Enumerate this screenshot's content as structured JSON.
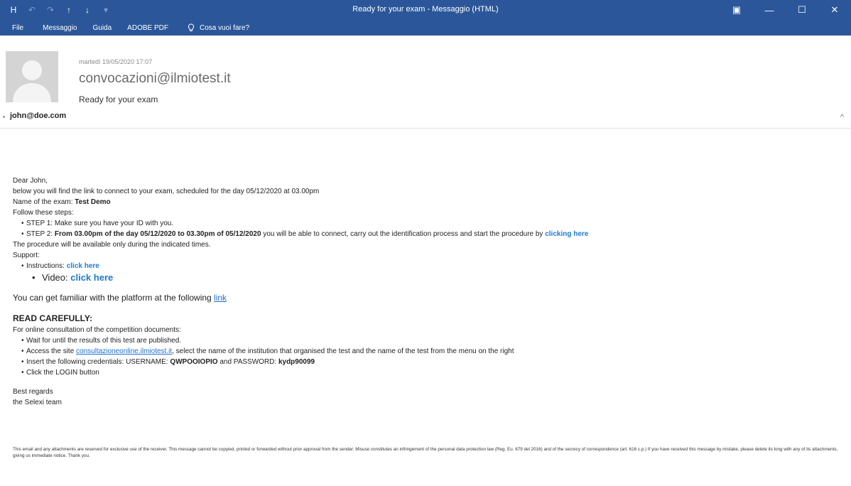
{
  "window": {
    "title": "Ready for your exam  -  Messaggio (HTML)",
    "controls": {
      "ribbon_options": "▣",
      "minimize": "—",
      "maximize": "☐",
      "close": "✕"
    }
  },
  "quick_access": {
    "save": "H",
    "undo": "↶",
    "redo": "↷",
    "up": "↑",
    "down": "↓",
    "more": "▾"
  },
  "ribbon": {
    "tabs": [
      "File",
      "Messaggio",
      "Guida",
      "ADOBE PDF"
    ],
    "tell_me": "Cosa vuoi fare?"
  },
  "header": {
    "date": "martedì 19/05/2020 17:07",
    "from": "convocazioni@ilmiotest.it",
    "subject": "Ready for your exam",
    "to": "john@doe.com",
    "collapse": "^"
  },
  "message": {
    "greeting": "Dear John,",
    "intro": "below you will find the link to connect to your exam, scheduled for the day 05/12/2020 at 03.00pm",
    "exam_label": "Name of the exam: ",
    "exam_name": "Test Demo",
    "steps_intro": "Follow these steps:",
    "step1": "STEP 1: Make sure you have your ID with you.",
    "step2_prefix": "STEP 2: ",
    "step2_bold": "From 03.00pm of the day 05/12/2020 to 03.30pm of 05/12/2020",
    "step2_text": " you will be able to connect, carry out the identification process and start the procedure by ",
    "step2_link": "clicking here",
    "availability": "The procedure will be available only during the indicated times.",
    "support_label": "Support:",
    "instructions_label": "Instructions: ",
    "instructions_link": "click here",
    "video_label": "Video: ",
    "video_link": "click here",
    "platform_text": "You can get familiar with the platform at the following ",
    "platform_link": "link",
    "read_carefully": "READ CAREFULLY:",
    "consult_intro": "For online consultation of the competition documents:",
    "consult1": "Wait for until the results of this test are published.",
    "consult2_prefix": "Access the site ",
    "consult2_link": "consultazioneonline.ilmiotest.it",
    "consult2_text": ", select the name of the institution that organised the test and the name of the test from the menu on the right",
    "consult3_prefix": "Insert the following credentials: USERNAME: ",
    "username": "QWPOOIOPIO",
    "consult3_mid": "  and PASSWORD: ",
    "password": "kydp90099",
    "consult4": "Click the LOGIN button",
    "regards": "Best regards",
    "signature": "the Selexi team",
    "disclaimer": "This email and any attachments are reserved for exclusive use of the receiver. This message cannot be copyied, printed or forwarded without prior approval from the sender. Misuse constitutes an infringement of the personal data protection law (Reg. Eu. 679 del 2016) and of the secrecy of correspondence (art. 616 c.p.) If you have received this message by mistake, please delete its long with any of its attachments, giving us immediate notice. Thank you."
  }
}
